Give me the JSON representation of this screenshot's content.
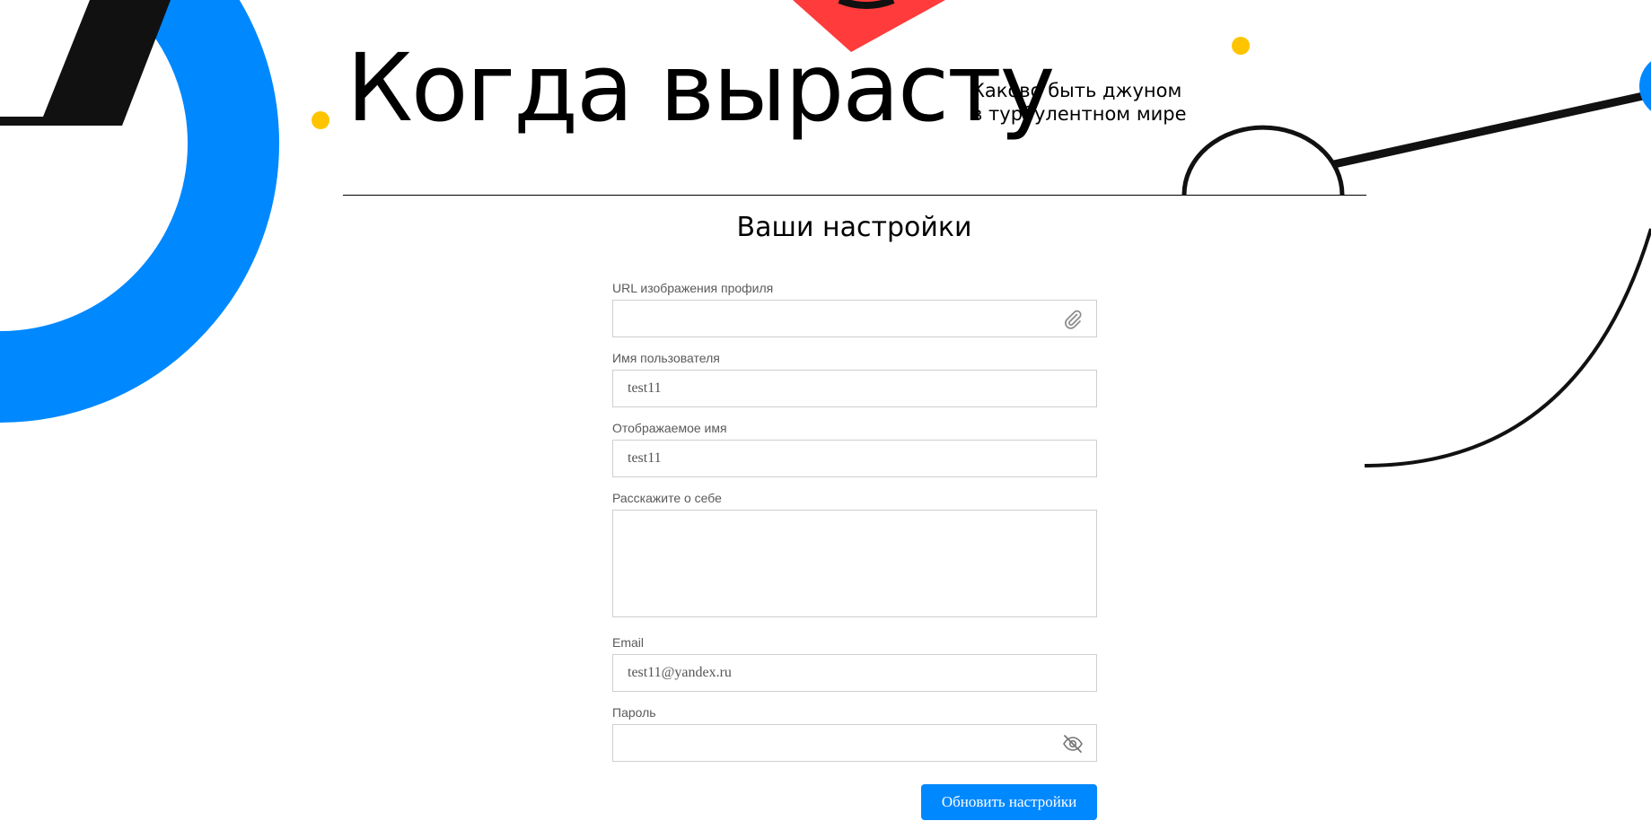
{
  "header": {
    "title": "Когда вырасту",
    "subtitle_line1": "Каково быть джуном",
    "subtitle_line2": "в турбулентном мире"
  },
  "settings": {
    "title": "Ваши настройки"
  },
  "form": {
    "image_url": {
      "label": "URL изображения профиля",
      "value": ""
    },
    "username": {
      "label": "Имя пользователя",
      "value": "test11"
    },
    "display_name": {
      "label": "Отображаемое имя",
      "value": "test11"
    },
    "about": {
      "label": "Расскажите о себе",
      "value": ""
    },
    "email": {
      "label": "Email",
      "value": "test11@yandex.ru"
    },
    "password": {
      "label": "Пароль",
      "value": ""
    },
    "submit_label": "Обновить настройки"
  },
  "icons": {
    "attach": "paperclip-icon",
    "password_toggle": "eye-off-icon"
  },
  "colors": {
    "accent_blue": "#0088ff",
    "accent_red": "#ff3b3b",
    "accent_yellow": "#ffc400",
    "text": "#000000"
  }
}
